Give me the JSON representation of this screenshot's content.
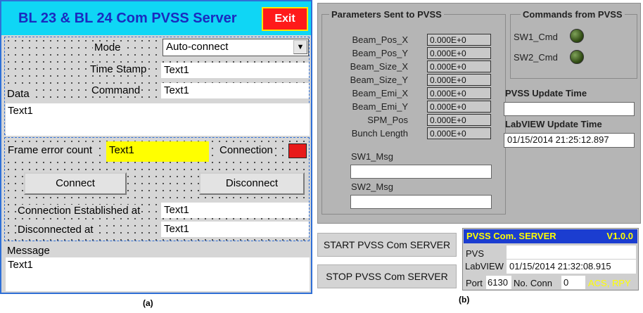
{
  "panel_a": {
    "title": "BL 23 & BL 24 Com PVSS Server",
    "exit_label": "Exit",
    "mode_label": "Mode",
    "mode_value": "Auto-connect",
    "timestamp_label": "Time Stamp",
    "timestamp_value": "Text1",
    "data_label": "Data",
    "command_label": "Command",
    "command_value": "Text1",
    "data_value": "Text1",
    "frame_error_label": "Frame error count",
    "frame_error_value": "Text1",
    "connection_label": "Connection",
    "connect_button": "Connect",
    "disconnect_button": "Disconnect",
    "conn_established_label": "Connection Established at",
    "conn_established_value": "Text1",
    "disconnected_label": "Disconnected at",
    "disconnected_value": "Text1",
    "message_label": "Message",
    "message_value": "Text1",
    "colors": {
      "header": "#0fd6f5",
      "title": "#1a2bbf",
      "exit": "#ff1a1a",
      "frame_error_bg": "#ffff00",
      "connection_indicator": "#e81a1a"
    }
  },
  "panel_b": {
    "params_group_title": "Parameters Sent to PVSS",
    "params": [
      {
        "label": "Beam_Pos_X",
        "value": "0.000E+0"
      },
      {
        "label": "Beam_Pos_Y",
        "value": "0.000E+0"
      },
      {
        "label": "Beam_Size_X",
        "value": "0.000E+0"
      },
      {
        "label": "Beam_Size_Y",
        "value": "0.000E+0"
      },
      {
        "label": "Beam_Emi_X",
        "value": "0.000E+0"
      },
      {
        "label": "Beam_Emi_Y",
        "value": "0.000E+0"
      },
      {
        "label": "SPM_Pos",
        "value": "0.000E+0"
      },
      {
        "label": "Bunch Length",
        "value": "0.000E+0"
      }
    ],
    "sw1_msg_label": "SW1_Msg",
    "sw1_msg_value": "",
    "sw2_msg_label": "SW2_Msg",
    "sw2_msg_value": "",
    "commands_group_title": "Commands from PVSS",
    "sw1_cmd_label": "SW1_Cmd",
    "sw2_cmd_label": "SW2_Cmd",
    "pvss_update_label": "PVSS Update Time",
    "pvss_update_value": "",
    "labview_update_label": "LabVIEW Update Time",
    "labview_update_value": "01/15/2014 21:25:12.897",
    "start_button": "START PVSS Com SERVER",
    "stop_button": "STOP PVSS Com SERVER",
    "server": {
      "title": "PVSS Com. SERVER",
      "version": "V1.0.0",
      "pvs_label": "PVS",
      "labview_label": "LabVIEW",
      "labview_value": "01/15/2014 21:32:08.915",
      "port_label": "Port",
      "port_value": "6130",
      "no_conn_label": "No. Conn",
      "no_conn_value": "0",
      "credit": "ACS, RPY"
    },
    "colors": {
      "panel": "#b5b5b5",
      "led": "#3d5a1a",
      "server_title_bg": "#1b3dd0",
      "server_title_text": "#ffff00",
      "credit": "#ffff00"
    }
  },
  "captions": {
    "a": "(a)",
    "b": "(b)"
  }
}
